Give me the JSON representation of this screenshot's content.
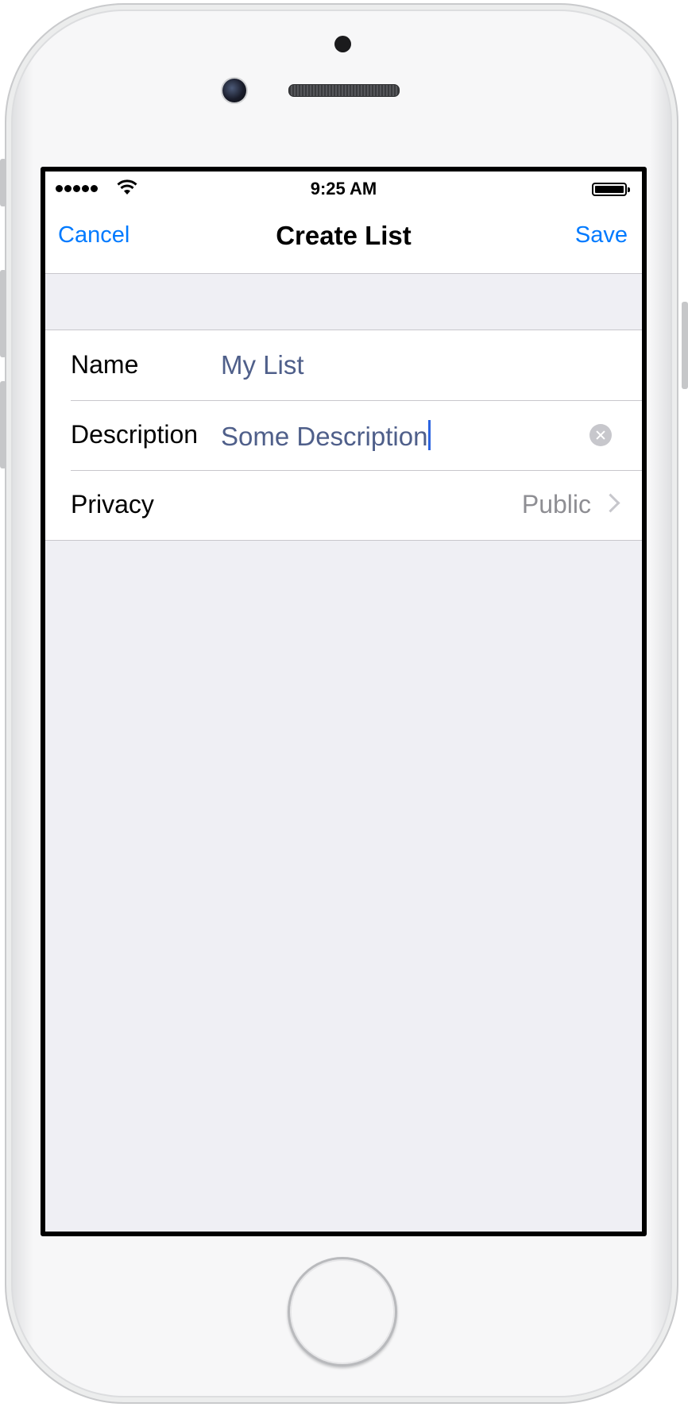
{
  "status_bar": {
    "time": "9:25 AM"
  },
  "nav_bar": {
    "cancel_label": "Cancel",
    "title": "Create List",
    "save_label": "Save"
  },
  "form": {
    "name": {
      "label": "Name",
      "value": "My List"
    },
    "description": {
      "label": "Description",
      "value": "Some Description"
    },
    "privacy": {
      "label": "Privacy",
      "value": "Public"
    }
  },
  "colors": {
    "accent": "#007aff",
    "field_value": "#4f5f8a",
    "background": "#efeff4"
  },
  "icons": [
    "signal-dots-icon",
    "wifi-icon",
    "battery-icon",
    "clear-text-icon",
    "chevron-right-icon"
  ]
}
